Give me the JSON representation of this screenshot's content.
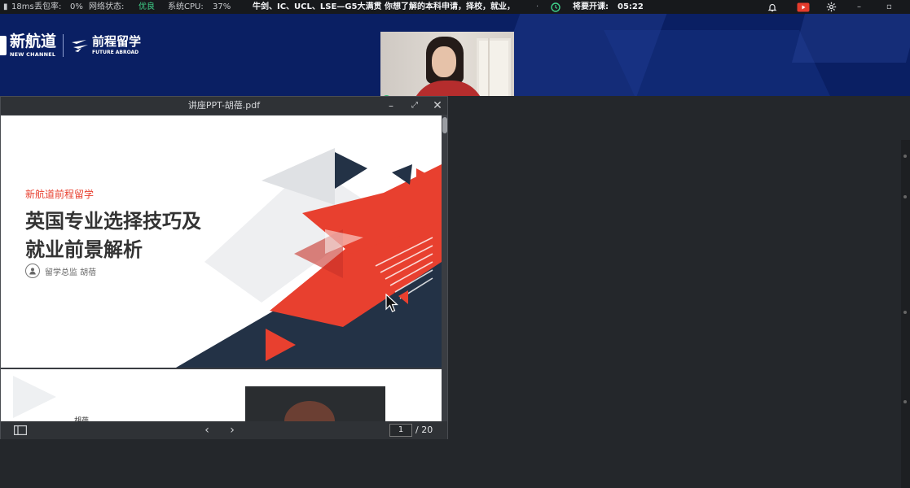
{
  "status": {
    "latency": "18ms",
    "loss_label": "丢包率:",
    "loss_value": "0%",
    "net_label": "网络状态:",
    "net_value": "优良",
    "cpu_label": "系统CPU:",
    "cpu_value": "37%",
    "marquee": "牛剑、IC、UCL、LSE—G5大满贯 你想了解的本科申请，择校，就业，",
    "countdown_label": "将要开课:",
    "countdown_value": "05:22"
  },
  "header": {
    "logo_cn": "新航道",
    "logo_en": "NEW CHANNEL",
    "brand_cn": "前程留学",
    "brand_en": "FUTURE ABROAD",
    "presenter_name": "胡蓓"
  },
  "pdf": {
    "title": "讲座PPT-胡蓓.pdf",
    "slide_org": "新航道前程留学",
    "slide_title_line1": "英国专业选择技巧及",
    "slide_title_line2": "就业前景解析",
    "slide_presenter": "留学总监 胡蓓",
    "page2_name": "胡蓓",
    "page_current": "1",
    "page_total": "/ 20"
  },
  "colors": {
    "accent_red": "#e8402f",
    "navy": "#233246",
    "status_green": "#3fd28a",
    "header_blue": "#0a1f63"
  }
}
